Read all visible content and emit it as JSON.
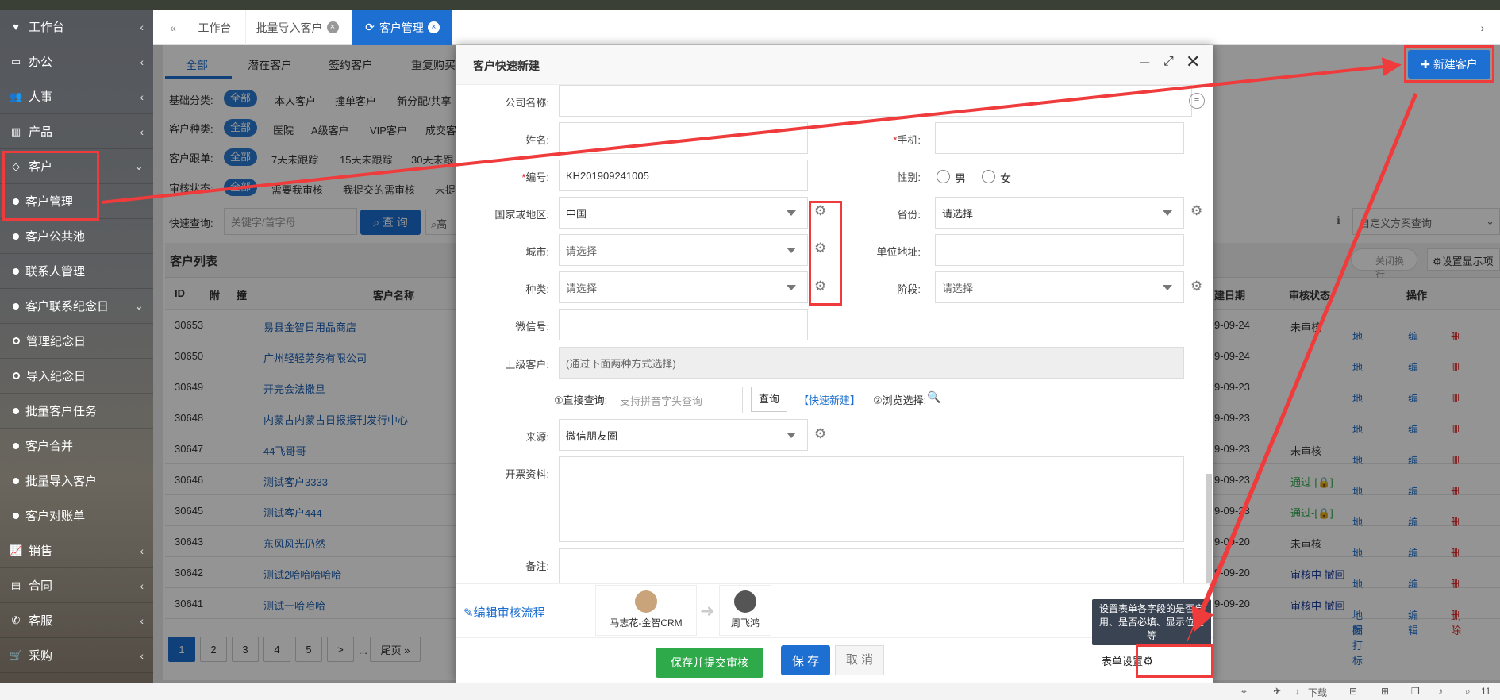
{
  "sidebar": {
    "items": [
      {
        "label": "工作台",
        "icon": "heart-icon"
      },
      {
        "label": "办公",
        "icon": "laptop-icon"
      },
      {
        "label": "人事",
        "icon": "users-icon"
      },
      {
        "label": "产品",
        "icon": "barcode-icon"
      },
      {
        "label": "客户",
        "icon": "diamond-icon"
      },
      {
        "label": "客户管理"
      },
      {
        "label": "客户公共池"
      },
      {
        "label": "联系人管理"
      },
      {
        "label": "客户联系纪念日"
      },
      {
        "label": "管理纪念日"
      },
      {
        "label": "导入纪念日"
      },
      {
        "label": "批量客户任务"
      },
      {
        "label": "客户合并"
      },
      {
        "label": "批量导入客户"
      },
      {
        "label": "客户对账单"
      },
      {
        "label": "销售",
        "icon": "chart-icon"
      },
      {
        "label": "合同",
        "icon": "contract-icon"
      },
      {
        "label": "客服",
        "icon": "phone-icon"
      },
      {
        "label": "采购",
        "icon": "cart-icon"
      }
    ]
  },
  "tabs": {
    "home": "工作台",
    "import": "批量导入客户",
    "active": "客户管理"
  },
  "filter_tabs": [
    "全部",
    "潜在客户",
    "签约客户",
    "重复购买"
  ],
  "filters": {
    "basic": {
      "label": "基础分类:",
      "all": "全部",
      "opts": [
        "本人客户",
        "撞单客户",
        "新分配/共享"
      ]
    },
    "kind": {
      "label": "客户种类:",
      "all": "全部",
      "opts": [
        "医院",
        "A级客户",
        "VIP客户",
        "成交客"
      ]
    },
    "follow": {
      "label": "客户跟单:",
      "all": "全部",
      "opts": [
        "7天未跟踪",
        "15天未跟踪",
        "30天未跟"
      ]
    },
    "audit": {
      "label": "审核状态:",
      "all": "全部",
      "opts": [
        "需要我审核",
        "我提交的需审核",
        "未提"
      ]
    }
  },
  "quick_search": {
    "label": "快速查询:",
    "placeholder": "关键字/首字母",
    "button": "查 询",
    "advanced": "高"
  },
  "custom_query": "自定义方案查询",
  "list": {
    "title": "客户列表",
    "close_wrap": "关闭换行",
    "display_settings": "设置显示项",
    "headers": {
      "id": "ID",
      "attach": "附",
      "collide": "撞",
      "name": "客户名称",
      "date": "建日期",
      "audit": "审核状态",
      "ops": "操作"
    },
    "rows": [
      {
        "id": "30653",
        "name": "易县金智日用品商店",
        "date": "9-09-24",
        "audit": "未审核"
      },
      {
        "id": "30650",
        "name": "广州轻轻劳务有限公司",
        "date": "9-09-24",
        "audit": ""
      },
      {
        "id": "30649",
        "name": "开完会法撒旦",
        "date": "9-09-23",
        "audit": ""
      },
      {
        "id": "30648",
        "name": "内蒙古内蒙古日报报刊发行中心",
        "date": "9-09-23",
        "audit": ""
      },
      {
        "id": "30647",
        "name": "44飞哥哥",
        "date": "9-09-23",
        "audit": "未审核"
      },
      {
        "id": "30646",
        "name": "测试客户3333",
        "date": "9-09-23",
        "audit": "通过-[🔒]"
      },
      {
        "id": "30645",
        "name": "测试客户444",
        "date": "9-09-23",
        "audit": "通过-[🔒]"
      },
      {
        "id": "30643",
        "name": "东风风光仍然",
        "date": "9-09-20",
        "audit": "未审核"
      },
      {
        "id": "30642",
        "name": "测试2哈哈哈哈哈",
        "date": "9-09-20",
        "audit": "审核中 撤回"
      },
      {
        "id": "30641",
        "name": "测试一哈哈哈",
        "date": "9-09-20",
        "audit": "审核中 撤回"
      }
    ],
    "ops": {
      "map": "地图打标",
      "edit": "编辑",
      "del": "删除"
    }
  },
  "pagination": {
    "pages": [
      "1",
      "2",
      "3",
      "4",
      "5"
    ],
    "next": ">",
    "ellipsis": "...",
    "last": "尾页 »"
  },
  "new_customer_button": "新建客户",
  "modal": {
    "title": "客户快速新建",
    "fields": {
      "company": "公司名称:",
      "name": "姓名:",
      "mobile": "手机:",
      "code": "编号:",
      "code_value": "KH201909241005",
      "gender": "性别:",
      "male": "男",
      "female": "女",
      "country": "国家或地区:",
      "country_value": "中国",
      "province": "省份:",
      "province_value": "请选择",
      "city": "城市:",
      "city_value": "请选择",
      "address": "单位地址:",
      "kind": "种类:",
      "kind_value": "请选择",
      "stage": "阶段:",
      "stage_value": "请选择",
      "wechat": "微信号:",
      "parent": "上级客户:",
      "parent_placeholder": "(通过下面两种方式选择)",
      "direct": "①直接查询:",
      "direct_placeholder": "支持拼音字头查询",
      "query_btn": "查询",
      "quick_new": "【快速新建】",
      "browse": "②浏览选择:",
      "source": "来源:",
      "source_value": "微信朋友圈",
      "invoice": "开票资料:",
      "remark": "备注:"
    },
    "flow": {
      "edit": "编辑审核流程",
      "person1": "马志花-金智CRM",
      "person2": "周飞鸿"
    },
    "buttons": {
      "submit": "保存并提交审核",
      "save": "保 存",
      "cancel": "取 消",
      "form_settings": "表单设置"
    },
    "tooltip": "设置表单各字段的是否启用、是否必填、显示位置等"
  },
  "statusbar": {
    "download": "下载",
    "zoom": "11"
  },
  "colors": {
    "primary": "#1d6fd1",
    "danger": "#e02020",
    "success": "#2eaa4a",
    "annotation": "#ef3b3b"
  }
}
